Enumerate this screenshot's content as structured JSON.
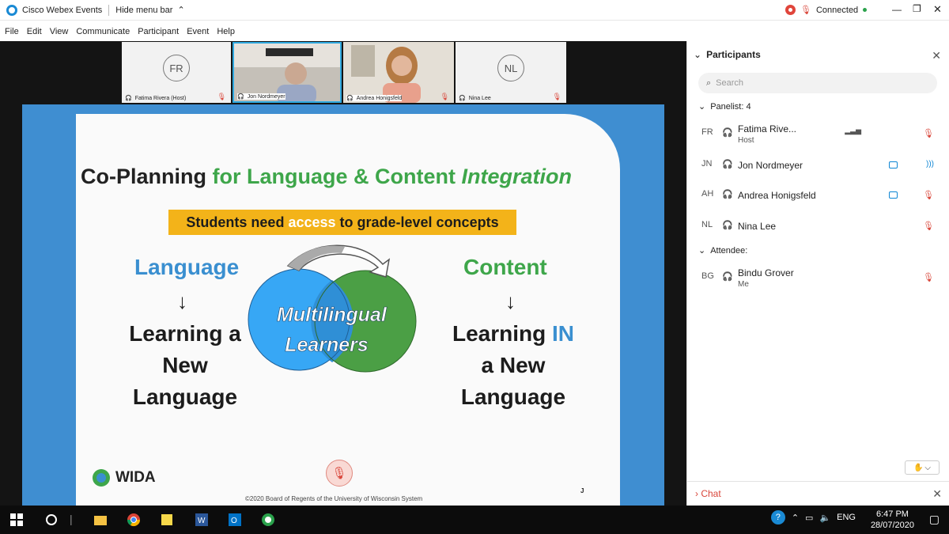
{
  "window": {
    "title": "Cisco Webex Events",
    "hide_menu": "Hide menu bar",
    "status": "Connected"
  },
  "menu": [
    "File",
    "Edit",
    "View",
    "Communicate",
    "Participant",
    "Event",
    "Help"
  ],
  "thumbnails": [
    {
      "initials": "FR",
      "label": "Fatima Rivera (Host)"
    },
    {
      "initials": "",
      "label": "Jon Nordmeyer"
    },
    {
      "initials": "",
      "label": "Andrea Honigsfeld"
    },
    {
      "initials": "NL",
      "label": "Nina Lee"
    }
  ],
  "slide": {
    "title_a": "Co-Planning",
    "title_b": "for Language & Content",
    "title_c": "Integration",
    "banner_a": "Students need",
    "banner_b": "access",
    "banner_c": "to grade-level concepts",
    "left_head": "Language",
    "left_l1": "Learning a",
    "left_l2": "New",
    "left_l3": "Language",
    "right_head": "Content",
    "right_l1a": "Learning",
    "right_l1b": "IN",
    "right_l2": "a New",
    "right_l3": "Language",
    "center_l1": "Multilingual",
    "center_l2": "Learners",
    "logo": "WIDA",
    "copyright": "©2020 Board of Regents of the University of Wisconsin System",
    "corner": "J"
  },
  "panel": {
    "title": "Participants",
    "search_placeholder": "Search",
    "panelist_header": "Panelist: 4",
    "attendee_header": "Attendee:",
    "chat": "Chat",
    "panelists": [
      {
        "initials": "FR",
        "name": "Fatima Rive...",
        "role": "Host"
      },
      {
        "initials": "JN",
        "name": "Jon Nordmeyer",
        "role": ""
      },
      {
        "initials": "AH",
        "name": "Andrea Honigsfeld",
        "role": ""
      },
      {
        "initials": "NL",
        "name": "Nina Lee",
        "role": ""
      }
    ],
    "attendees": [
      {
        "initials": "BG",
        "name": "Bindu Grover",
        "role": "Me"
      }
    ]
  },
  "taskbar": {
    "lang": "ENG",
    "time": "6:47 PM",
    "date": "28/07/2020"
  },
  "colors": {
    "slide_blue": "#3f8ed1",
    "green": "#3ea64a",
    "banner": "#f3b319",
    "language_blue": "#3a8fd0",
    "mute_red": "#d9463a"
  }
}
